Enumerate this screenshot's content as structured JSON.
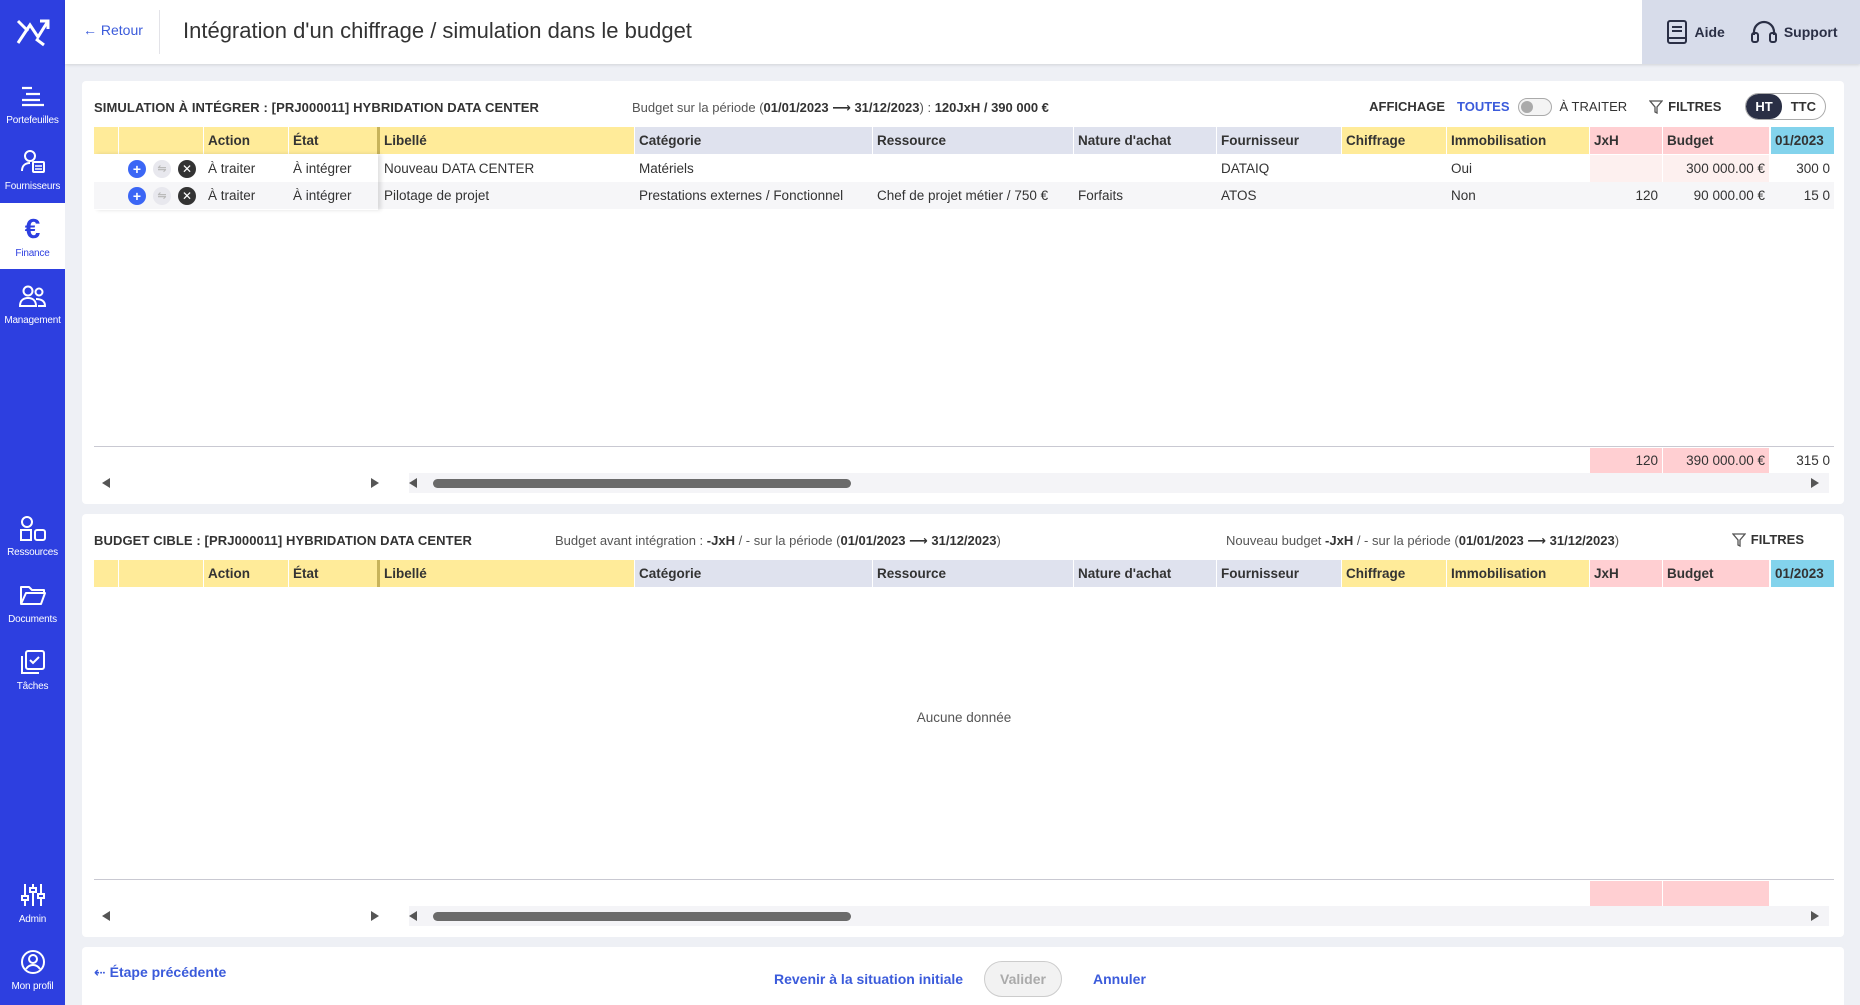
{
  "sidebar": {
    "logo_icon": "app-logo-icon",
    "items": [
      {
        "label": "Portefeuilles",
        "icon": "portfolio-icon"
      },
      {
        "label": "Fournisseurs",
        "icon": "suppliers-icon"
      },
      {
        "label": "Finance",
        "icon": "euro-icon"
      },
      {
        "label": "Management",
        "icon": "people-icon"
      },
      {
        "label": "Ressources",
        "icon": "shapes-icon"
      },
      {
        "label": "Documents",
        "icon": "folder-icon"
      },
      {
        "label": "Tâches",
        "icon": "tasks-icon"
      },
      {
        "label": "Admin",
        "icon": "sliders-icon"
      },
      {
        "label": "Mon profil",
        "icon": "user-circle-icon"
      }
    ]
  },
  "header": {
    "back_label": "← Retour",
    "title": "Intégration d'un chiffrage / simulation dans le budget",
    "help_label": "Aide",
    "support_label": "Support"
  },
  "columns": [
    "Action",
    "État",
    "Libellé",
    "Catégorie",
    "Ressource",
    "Nature d'achat",
    "Fournisseur",
    "Chiffrage",
    "Immobilisation",
    "JxH",
    "Budget",
    "01/2023"
  ],
  "panel1": {
    "title": "SIMULATION À INTÉGRER : [PRJ000011] HYBRIDATION DATA CENTER",
    "info_prefix": "Budget sur la période (",
    "info_period": "01/01/2023 ⟶ 31/12/2023",
    "info_mid": ") : ",
    "info_values": "120JxH / 390 000 €",
    "display_label": "AFFICHAGE",
    "all_label": "TOUTES",
    "to_treat_label": "À TRAITER",
    "filters_label": "FILTRES",
    "ht_label": "HT",
    "ttc_label": "TTC",
    "rows": [
      {
        "action": "À traiter",
        "etat": "À intégrer",
        "libelle": "Nouveau DATA CENTER",
        "categorie": "Matériels",
        "ressource": "",
        "nature": "",
        "fournisseur": "DATAIQ",
        "chiffrage": "",
        "immobilisation": "Oui",
        "jxh": "",
        "budget": "300 000.00 €",
        "month": "300 0"
      },
      {
        "action": "À traiter",
        "etat": "À intégrer",
        "libelle": "Pilotage de projet",
        "categorie": "Prestations externes / Fonctionnel",
        "ressource": "Chef de projet métier / 750 €",
        "nature": "Forfaits",
        "fournisseur": "ATOS",
        "chiffrage": "",
        "immobilisation": "Non",
        "jxh": "120",
        "budget": "90 000.00 €",
        "month": "15 0"
      }
    ],
    "totals": {
      "jxh": "120",
      "budget": "390 000.00 €",
      "month": "315 0"
    }
  },
  "panel2": {
    "title": "BUDGET CIBLE : [PRJ000011] HYBRIDATION DATA CENTER",
    "info1_prefix": "Budget avant intégration : ",
    "info1_val": "-JxH",
    "info1_mid": " / - sur la période (",
    "info1_period": "01/01/2023 ⟶ 31/12/2023",
    "info1_suffix": ")",
    "info2_prefix": "Nouveau budget ",
    "info2_val": "-JxH",
    "info2_mid": " / - sur la période (",
    "info2_period": "01/01/2023 ⟶ 31/12/2023",
    "info2_suffix": ")",
    "filters_label": "FILTRES",
    "empty_label": "Aucune donnée"
  },
  "footer": {
    "prev_label": "⇠ Étape précédente",
    "reset_label": "Revenir à la situation initiale",
    "validate_label": "Valider",
    "cancel_label": "Annuler"
  },
  "colors": {
    "sidebar": "#2d3fe0",
    "accent": "#3b5bdb",
    "yellow_col": "#ffeb99",
    "grey_col": "#dfe2ee",
    "pink_col": "#ffcfd2",
    "blue_col": "#83d3ec"
  }
}
